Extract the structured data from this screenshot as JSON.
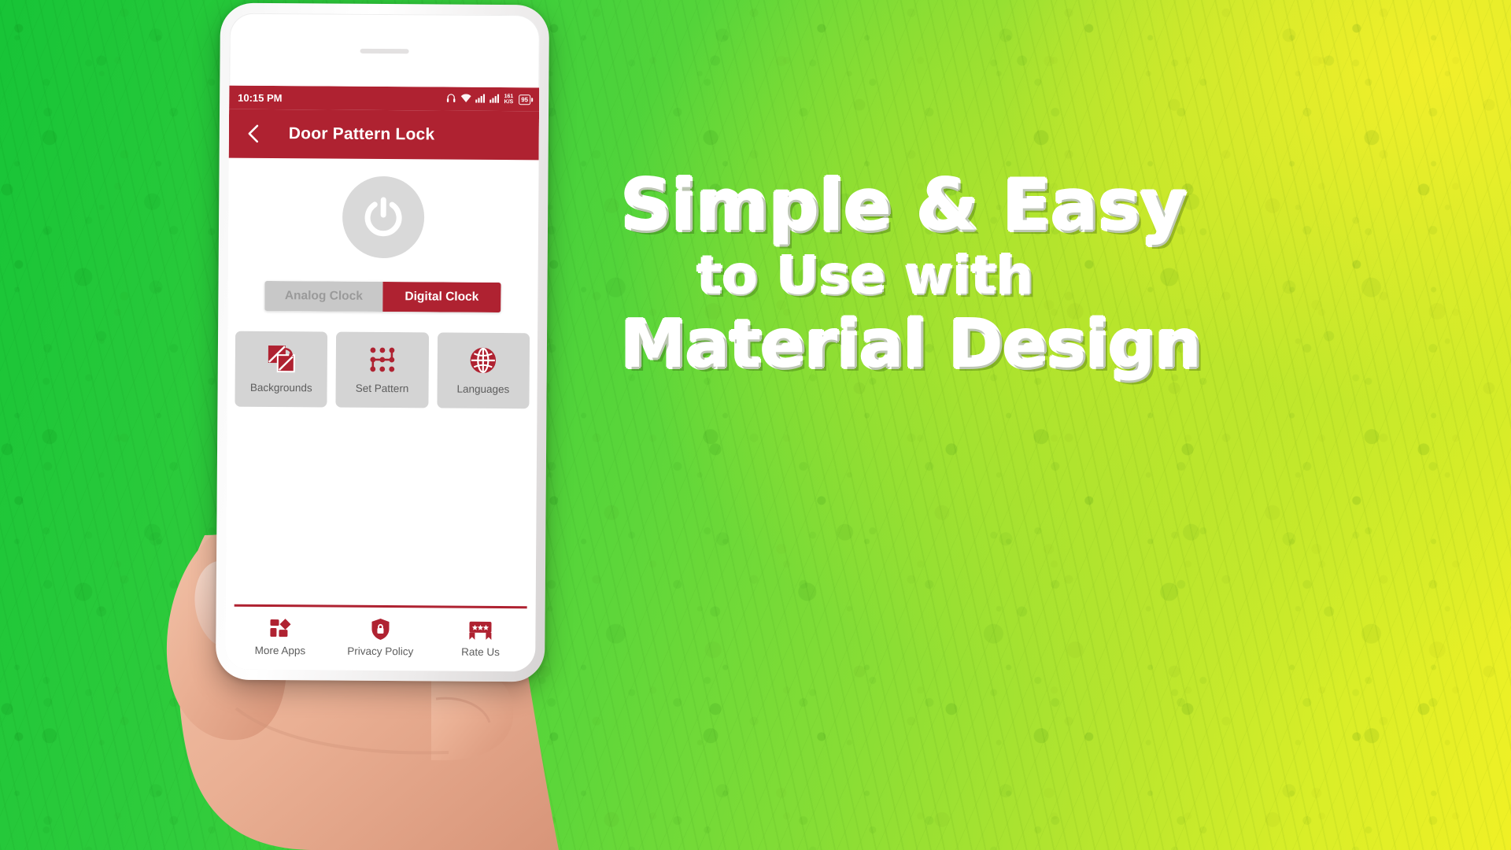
{
  "banner": {
    "marketing_lines": [
      "Simple & Easy",
      "to Use with",
      "Material Design"
    ],
    "accent_color": "#AF2231",
    "background_colors": [
      "#17c437",
      "#b6e52e",
      "#f0f025"
    ]
  },
  "phone": {
    "status_bar": {
      "time": "10:15 PM",
      "net_speed_value": "161",
      "net_speed_unit": "K/S",
      "battery_level": "95",
      "icons": [
        "headphones-icon",
        "wifi-icon",
        "signal-bars-icon",
        "signal-bars-2-icon",
        "battery-icon"
      ]
    },
    "app_bar": {
      "back_icon": "chevron-left-icon",
      "title": "Door Pattern Lock"
    },
    "content": {
      "power_button_icon": "power-icon",
      "clock_toggle": {
        "options": [
          "Analog Clock",
          "Digital Clock"
        ],
        "selected": "Digital Clock"
      },
      "feature_cards": [
        {
          "label": "Backgrounds",
          "icon": "images-swap-icon"
        },
        {
          "label": "Set Pattern",
          "icon": "pattern-dots-icon"
        },
        {
          "label": "Languages",
          "icon": "globe-icon"
        }
      ]
    },
    "bottom_nav": [
      {
        "label": "More Apps",
        "icon": "apps-grid-icon"
      },
      {
        "label": "Privacy Policy",
        "icon": "shield-lock-icon"
      },
      {
        "label": "Rate Us",
        "icon": "stars-ribbon-icon"
      }
    ]
  }
}
